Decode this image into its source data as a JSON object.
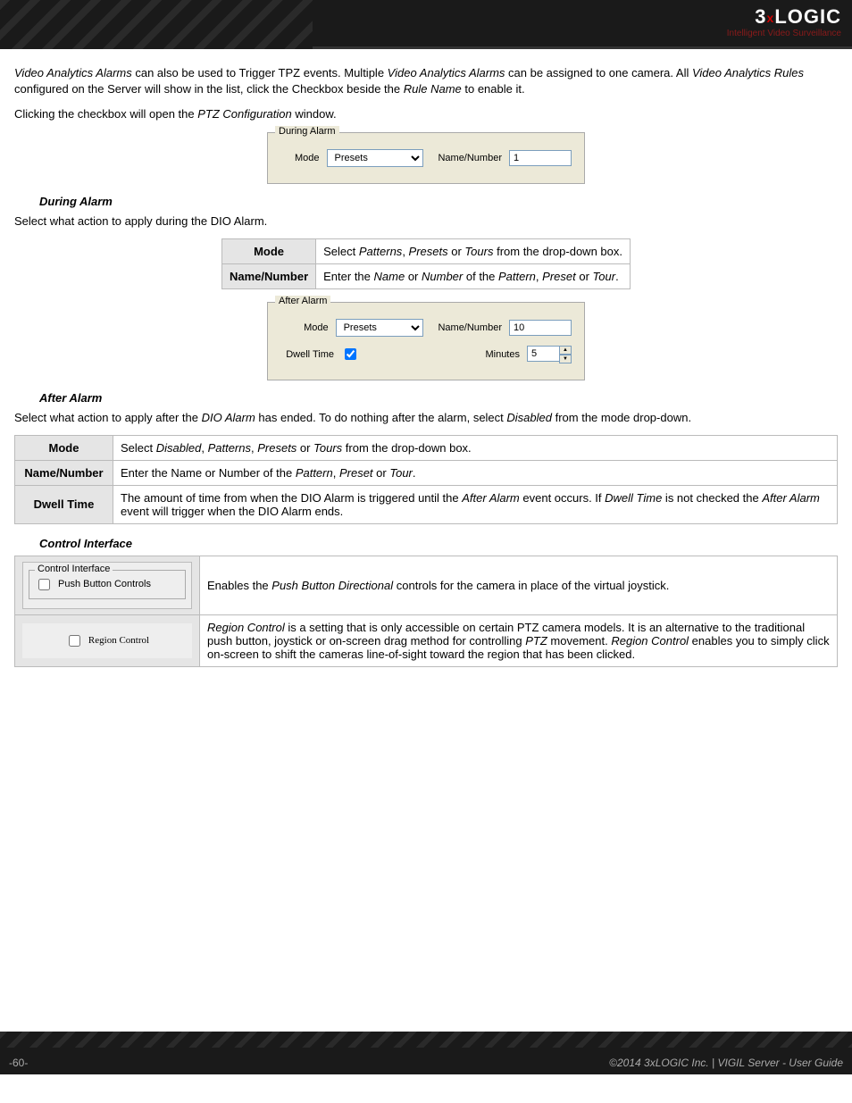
{
  "header": {
    "logo_main_pre": "3",
    "logo_main_x": "x",
    "logo_main_post": "LOGIC",
    "logo_sub": "Intelligent Video Surveillance"
  },
  "intro": {
    "p1_a": "Video Analytics Alarms",
    "p1_b": " can also be used to Trigger TPZ events.  Multiple ",
    "p1_c": "Video Analytics Alarms",
    "p1_d": " can be assigned to one camera.  All ",
    "p1_e": "Video Analytics Rules",
    "p1_f": " configured on the Server will show in the list, click the Checkbox beside the ",
    "p1_g": "Rule Name",
    "p1_h": " to enable it.",
    "p2_a": "Clicking the checkbox will open the ",
    "p2_b": "PTZ Configuration",
    "p2_c": " window."
  },
  "during_fs": {
    "legend": "During Alarm",
    "mode_label": "Mode",
    "mode_value": "Presets",
    "namenum_label": "Name/Number",
    "namenum_value": "1"
  },
  "sections": {
    "during_heading": "During Alarm",
    "during_text": "Select what action to apply during the DIO Alarm.",
    "after_heading": "After Alarm",
    "after_text_a": "Select what action to apply after the ",
    "after_text_b": "DIO Alarm",
    "after_text_c": " has ended.  To do nothing after the alarm, select ",
    "after_text_d": "Disabled",
    "after_text_e": " from the mode drop-down.",
    "ctrl_heading": "Control Interface"
  },
  "during_table": {
    "r1_h": "Mode",
    "r1_a": "Select ",
    "r1_b": "Patterns",
    "r1_c": ", ",
    "r1_d": "Presets",
    "r1_e": " or ",
    "r1_f": "Tours",
    "r1_g": " from the drop-down box.",
    "r2_h": "Name/Number",
    "r2_a": "Enter the ",
    "r2_b": "Name",
    "r2_c": " or ",
    "r2_d": "Number",
    "r2_e": " of the ",
    "r2_f": "Pattern",
    "r2_g": ", ",
    "r2_h2": "Preset",
    "r2_i": " or ",
    "r2_j": "Tour",
    "r2_k": "."
  },
  "after_fs": {
    "legend": "After Alarm",
    "mode_label": "Mode",
    "mode_value": "Presets",
    "namenum_label": "Name/Number",
    "namenum_value": "10",
    "dwell_label": "Dwell Time",
    "minutes_label": "Minutes",
    "minutes_value": "5"
  },
  "after_table": {
    "r1_h": "Mode",
    "r1_a": "Select ",
    "r1_b": "Disabled",
    "r1_c": ", ",
    "r1_d": "Patterns",
    "r1_e": ", ",
    "r1_f": "Presets",
    "r1_g": " or ",
    "r1_h2": "Tours",
    "r1_i": " from the drop-down box.",
    "r2_h": "Name/Number",
    "r2_a": "Enter the Name or Number of the ",
    "r2_b": "Pattern",
    "r2_c": ", ",
    "r2_d": "Preset",
    "r2_e": " or ",
    "r2_f": "Tour",
    "r2_g": ".",
    "r3_h": "Dwell Time",
    "r3_a": "The amount of time from when the DIO Alarm is triggered until the ",
    "r3_b": "After Alarm",
    "r3_c": " event occurs.  If ",
    "r3_d": "Dwell Time",
    "r3_e": " is not checked the ",
    "r3_f": "After Alarm",
    "r3_g": " event will trigger when the DIO Alarm ends."
  },
  "ctrl_table": {
    "box1_legend": "Control Interface",
    "box1_label": "Push Button Controls",
    "r1_a": "Enables the ",
    "r1_b": "Push Button Directional",
    "r1_c": " controls for the camera in place of the virtual joystick.",
    "box2_label": "Region Control",
    "r2_a": "Region Control",
    "r2_b": " is a setting that is only accessible on certain PTZ camera models. It is an alternative to the traditional push button, joystick or on-screen drag method for controlling ",
    "r2_c": "PTZ",
    "r2_d": " movement. ",
    "r2_e": "Region Control",
    "r2_f": " enables you to simply click on-screen to shift the cameras line-of-sight toward the region that has been clicked."
  },
  "footer": {
    "page": "-60-",
    "copyright": "©2014 3xLOGIC Inc.  |  VIGIL Server - User Guide"
  }
}
